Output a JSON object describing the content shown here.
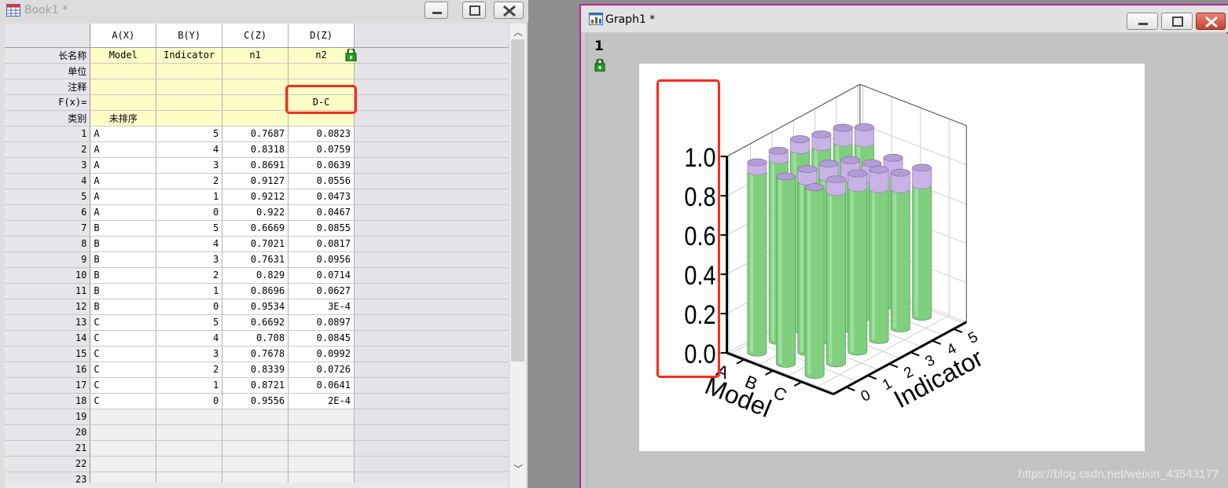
{
  "book": {
    "title": "Book1 *",
    "columns": [
      "A(X)",
      "B(Y)",
      "C(Z)",
      "D(Z)"
    ],
    "meta_rows": [
      {
        "label": "长名称",
        "values": [
          "Model",
          "Indicator",
          "n1",
          "n2"
        ]
      },
      {
        "label": "单位",
        "values": [
          "",
          "",
          "",
          ""
        ]
      },
      {
        "label": "注释",
        "values": [
          "",
          "",
          "",
          ""
        ]
      },
      {
        "label": "F(x)=",
        "values": [
          "",
          "",
          "",
          "D-C"
        ]
      },
      {
        "label": "类别",
        "values": [
          "未排序",
          "",
          "",
          ""
        ]
      }
    ],
    "rows": [
      {
        "n": "1",
        "a": "A",
        "b": "5",
        "c": "0.7687",
        "d": "0.0823"
      },
      {
        "n": "2",
        "a": "A",
        "b": "4",
        "c": "0.8318",
        "d": "0.0759"
      },
      {
        "n": "3",
        "a": "A",
        "b": "3",
        "c": "0.8691",
        "d": "0.0639"
      },
      {
        "n": "4",
        "a": "A",
        "b": "2",
        "c": "0.9127",
        "d": "0.0556"
      },
      {
        "n": "5",
        "a": "A",
        "b": "1",
        "c": "0.9212",
        "d": "0.0473"
      },
      {
        "n": "6",
        "a": "A",
        "b": "0",
        "c": "0.922",
        "d": "0.0467"
      },
      {
        "n": "7",
        "a": "B",
        "b": "5",
        "c": "0.6669",
        "d": "0.0855"
      },
      {
        "n": "8",
        "a": "B",
        "b": "4",
        "c": "0.7021",
        "d": "0.0817"
      },
      {
        "n": "9",
        "a": "B",
        "b": "3",
        "c": "0.7631",
        "d": "0.0956"
      },
      {
        "n": "10",
        "a": "B",
        "b": "2",
        "c": "0.829",
        "d": "0.0714"
      },
      {
        "n": "11",
        "a": "B",
        "b": "1",
        "c": "0.8696",
        "d": "0.0627"
      },
      {
        "n": "12",
        "a": "B",
        "b": "0",
        "c": "0.9534",
        "d": "3E-4"
      },
      {
        "n": "13",
        "a": "C",
        "b": "5",
        "c": "0.6692",
        "d": "0.0897"
      },
      {
        "n": "14",
        "a": "C",
        "b": "4",
        "c": "0.708",
        "d": "0.0845"
      },
      {
        "n": "15",
        "a": "C",
        "b": "3",
        "c": "0.7678",
        "d": "0.0992"
      },
      {
        "n": "16",
        "a": "C",
        "b": "2",
        "c": "0.8339",
        "d": "0.0726"
      },
      {
        "n": "17",
        "a": "C",
        "b": "1",
        "c": "0.8721",
        "d": "0.0641"
      },
      {
        "n": "18",
        "a": "C",
        "b": "0",
        "c": "0.9556",
        "d": "2E-4"
      }
    ],
    "empty_rows": [
      "19",
      "20",
      "21",
      "22",
      "23"
    ]
  },
  "graph": {
    "title": "Graph1 *",
    "layer": "1",
    "watermark": "https://blog.csdn.net/weixin_43543177"
  },
  "colors": {
    "cylinder_body": "#7fcf7f",
    "cylinder_cap": "#c9b3e6",
    "highlight": "#ff2a1a",
    "graph_border": "#b4289b"
  },
  "icons": {
    "book": "spreadsheet-icon",
    "graph": "graph-window-icon",
    "lock": "lock-icon"
  },
  "chart_data": {
    "type": "bar",
    "subtype": "3d-stacked-cylinder",
    "x_axis": {
      "label": "Model",
      "categories": [
        "A",
        "B",
        "C"
      ]
    },
    "y_axis": {
      "label": "Indicator",
      "ticks": [
        "0",
        "1",
        "2",
        "3",
        "4",
        "5"
      ]
    },
    "z_axis": {
      "ticks": [
        "0.0",
        "0.2",
        "0.4",
        "0.6",
        "0.8",
        "1.0"
      ],
      "range": [
        0,
        1
      ]
    },
    "series": [
      {
        "column": "n1",
        "values": [
          [
            0.922,
            0.9212,
            0.9127,
            0.8691,
            0.8318,
            0.7687
          ],
          [
            0.9534,
            0.8696,
            0.829,
            0.7631,
            0.7021,
            0.6669
          ],
          [
            0.9556,
            0.8721,
            0.8339,
            0.7678,
            0.708,
            0.6692
          ]
        ]
      },
      {
        "column": "n2",
        "values": [
          [
            0.0467,
            0.0473,
            0.0556,
            0.0639,
            0.0759,
            0.0823
          ],
          [
            0.0003,
            0.0627,
            0.0714,
            0.0956,
            0.0817,
            0.0855
          ],
          [
            0.0002,
            0.0641,
            0.0726,
            0.0992,
            0.0845,
            0.0897
          ]
        ]
      }
    ]
  }
}
